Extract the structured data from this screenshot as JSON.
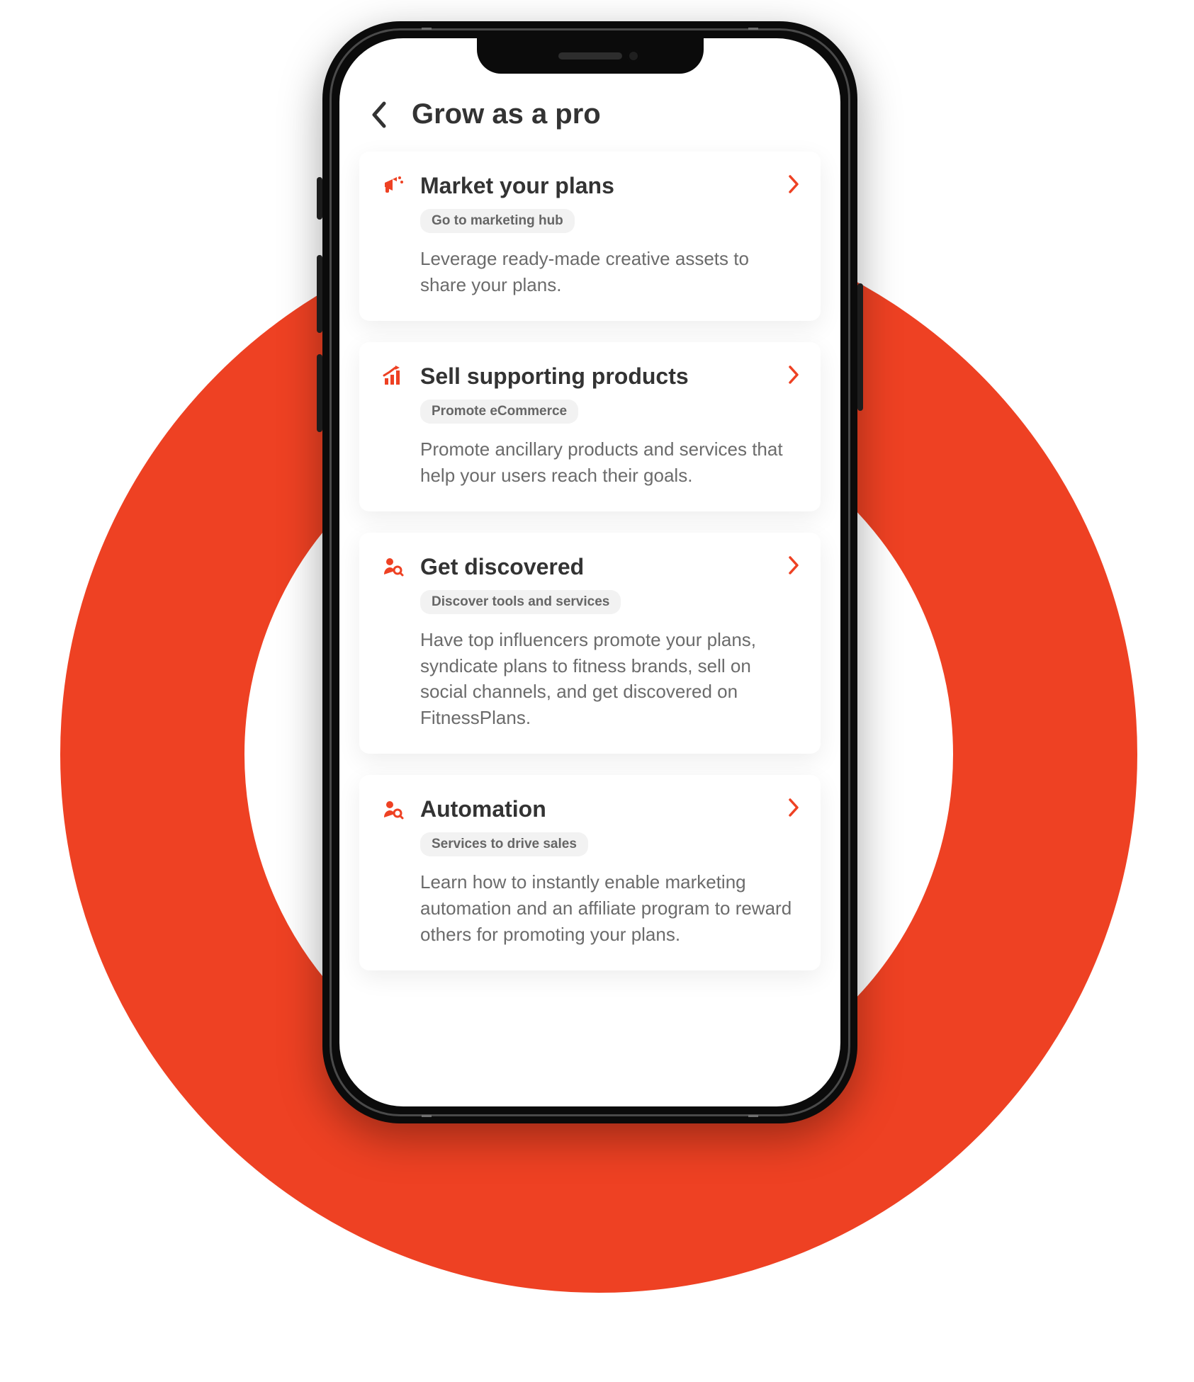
{
  "colors": {
    "accent": "#ee4123",
    "text": "#333333",
    "muted": "#6b6b6b"
  },
  "header": {
    "title": "Grow as a pro"
  },
  "cards": [
    {
      "icon": "megaphone",
      "title": "Market your plans",
      "chip": "Go to marketing hub",
      "desc": "Leverage ready-made creative assets to share your plans."
    },
    {
      "icon": "bars",
      "title": "Sell supporting products",
      "chip": "Promote eCommerce",
      "desc": "Promote ancillary products and services that help your users reach their goals."
    },
    {
      "icon": "person-search",
      "title": "Get discovered",
      "chip": "Discover tools and services",
      "desc": "Have top influencers promote your plans, syndicate plans to fitness brands, sell on social channels, and get discovered on FitnessPlans."
    },
    {
      "icon": "person-search",
      "title": "Automation",
      "chip": "Services to drive sales",
      "desc": "Learn how to instantly enable marketing automation and an affiliate program to reward others for promoting your plans."
    }
  ]
}
